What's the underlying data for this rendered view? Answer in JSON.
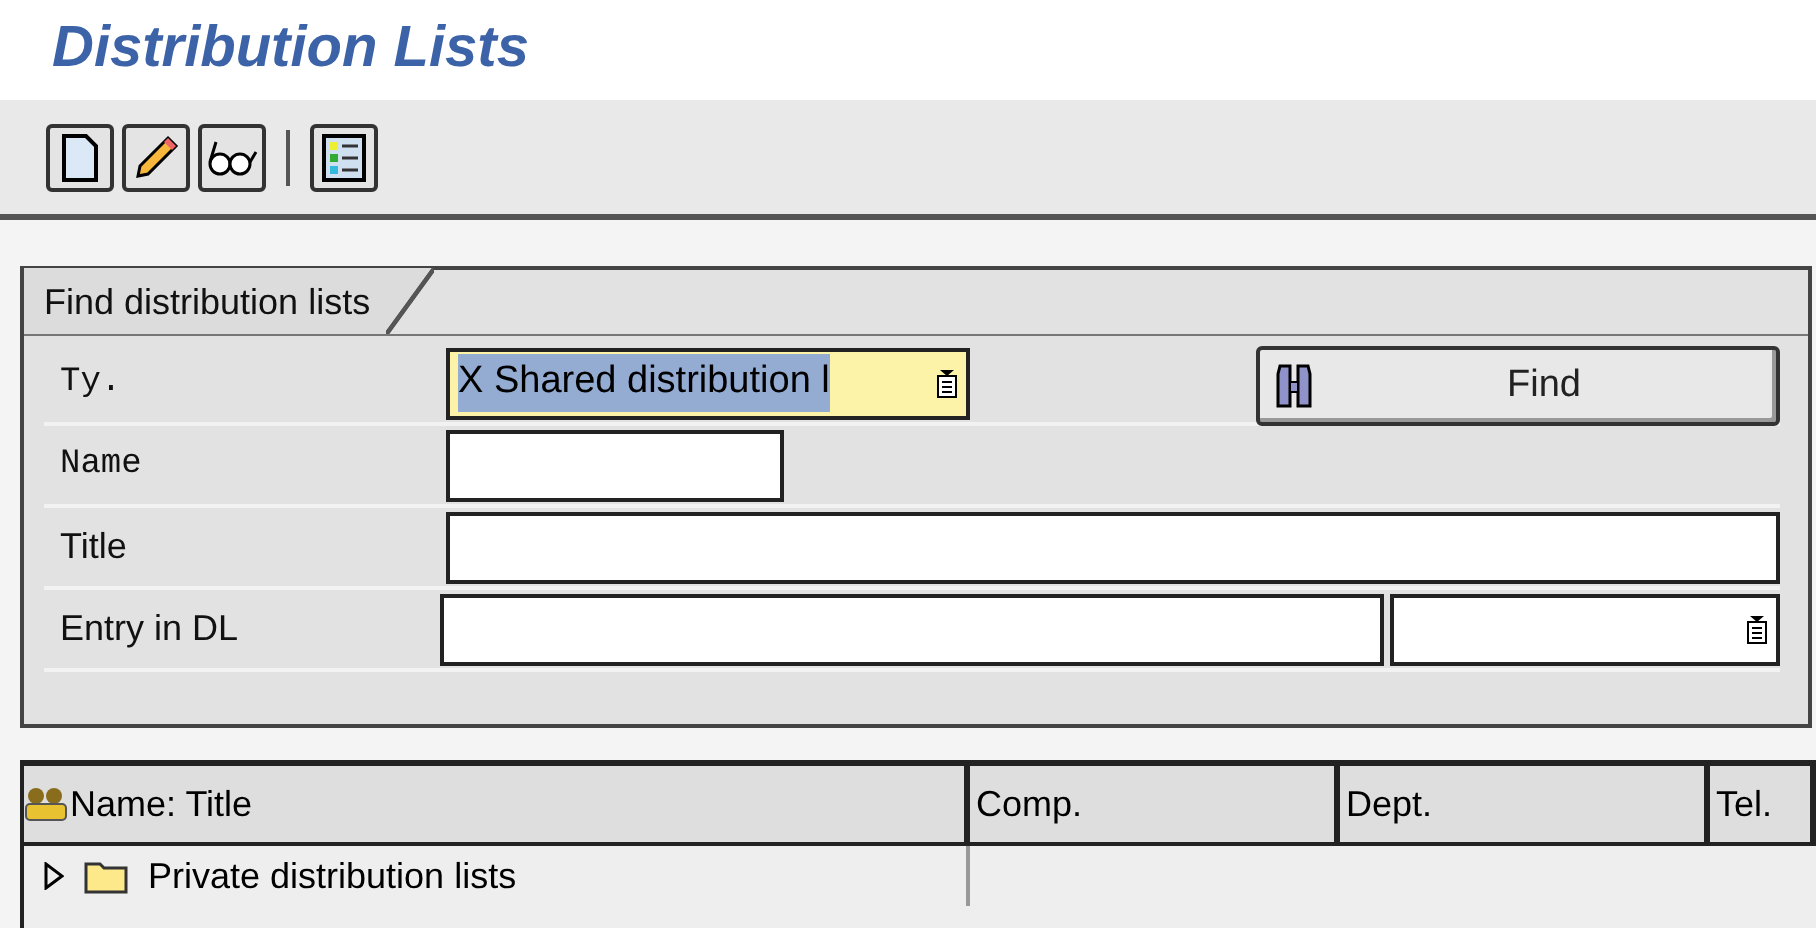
{
  "page": {
    "title": "Distribution Lists"
  },
  "search_panel": {
    "tab_label": "Find distribution lists",
    "find_button": {
      "label": "Find"
    },
    "fields": [
      {
        "label": "Ty.",
        "monospace_label": true,
        "value": "X Shared distribution l",
        "focused": true,
        "kind": "short"
      },
      {
        "label": "Name",
        "monospace_label": true,
        "kind": "name"
      },
      {
        "label": "Title",
        "monospace_label": false,
        "kind": "wide"
      },
      {
        "label": "Entry in DL",
        "monospace_label": false,
        "kind": "split"
      }
    ]
  },
  "tree_table": {
    "columns": [
      "Name: Title",
      "Comp.",
      "Dept.",
      "Tel."
    ],
    "rows": [
      {
        "label": "Private distribution lists",
        "expanded": false
      }
    ]
  }
}
